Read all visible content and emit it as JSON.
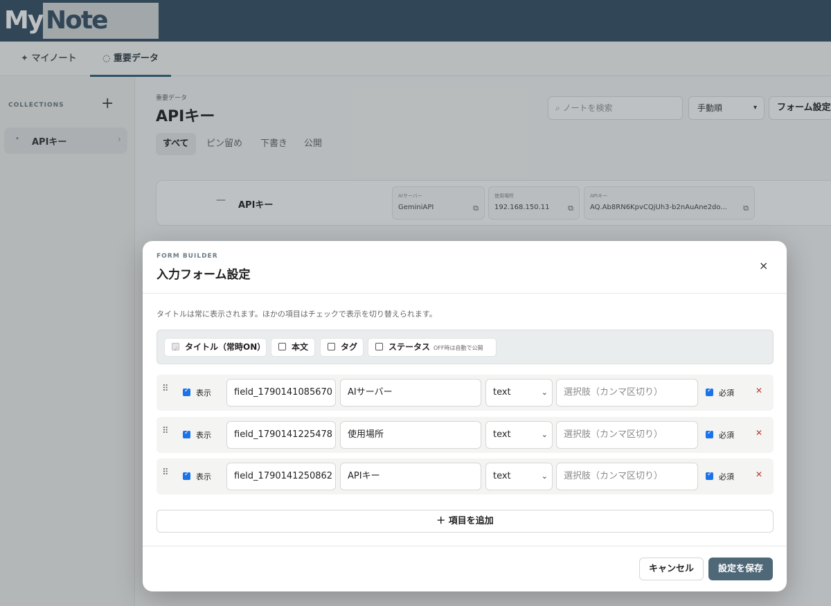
{
  "app": {
    "logo_my": "My",
    "logo_note": "Note",
    "nav_tabs": [
      {
        "icon": "✦",
        "label": "マイノート"
      },
      {
        "icon": "◌",
        "label": "重要データ"
      }
    ]
  },
  "sidebar": {
    "heading": "COLLECTIONS",
    "add_icon": "+",
    "items": [
      {
        "bullet": "•",
        "label": "APIキー",
        "chevron": "›"
      }
    ]
  },
  "main": {
    "breadcrumb": "重要データ",
    "title": "APIキー",
    "search_placeholder": "⌕ ノートを検索",
    "sort_value": "手動順",
    "form_settings_label": "フォーム設定",
    "filters": [
      "すべて",
      "ピン留め",
      "下書き",
      "公開"
    ],
    "card": {
      "dash": "—",
      "title": "APIキー",
      "fields": [
        {
          "label": "AIサーバー",
          "value": "GeminiAPI"
        },
        {
          "label": "使用場所",
          "value": "192.168.150.11"
        },
        {
          "label": "APIキー",
          "value": "AQ.Ab8RN6KpvCQjUh3-b2nAuAne2do..."
        }
      ]
    }
  },
  "modal": {
    "eyebrow": "FORM BUILDER",
    "title": "入力フォーム設定",
    "close_icon": "×",
    "hint": "タイトルは常に表示されます。ほかの項目はチェックで表示を切り替えられます。",
    "toggles": {
      "title_label": "タイトル（常時ON）",
      "body_label": "本文",
      "tag_label": "タグ",
      "status_label": "ステータス",
      "status_sub": "OFF時は自動で公開"
    },
    "field_rows": [
      {
        "show_label": "表示",
        "key": "field_1790141085670",
        "label": "AIサーバー",
        "type": "text",
        "options_placeholder": "選択肢（カンマ区切り）",
        "required_label": "必須"
      },
      {
        "show_label": "表示",
        "key": "field_1790141225478",
        "label": "使用場所",
        "type": "text",
        "options_placeholder": "選択肢（カンマ区切り）",
        "required_label": "必須"
      },
      {
        "show_label": "表示",
        "key": "field_1790141250862",
        "label": "APIキー",
        "type": "text",
        "options_placeholder": "選択肢（カンマ区切り）",
        "required_label": "必須"
      }
    ],
    "add_button": "＋ 項目を追加",
    "cancel_button": "キャンセル",
    "save_button": "設定を保存"
  },
  "colors": {
    "topbar": "#355063",
    "accent": "#4f6878",
    "checkbox": "#1a73e8",
    "delete": "#c0392b"
  }
}
